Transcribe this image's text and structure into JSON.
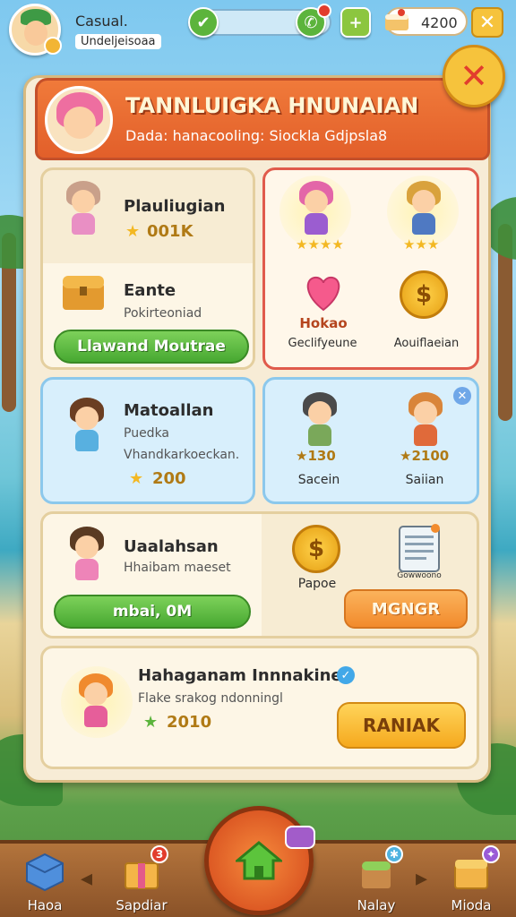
{
  "profile": {
    "name": "Casual.",
    "status": "Undeljeisoaa"
  },
  "currency": {
    "coins": "4200"
  },
  "panel": {
    "title": "TANNLUIGKA HNUNAIAN",
    "subtitle": "Dada: hanacooling: Siockla Gdjpsla8"
  },
  "cards": {
    "c1": {
      "name": "Plauliugian",
      "value": "001K"
    },
    "c2": {
      "name": "Eante",
      "desc": "Pokirteoniad",
      "button": "Llawand Moutrae"
    },
    "c3": {
      "char_a_stars": "★★★★",
      "char_b_stars": "★★★",
      "item_a_label": "Hokao",
      "item_a_caption": "Geclifyeune",
      "item_b_caption": "Aouiflaeian"
    },
    "c4": {
      "name": "Matoallan",
      "line1": "Puedka",
      "line2": "Vhandkarkoeckan.",
      "value": "200"
    },
    "c5": {
      "char_a_value": "★130",
      "char_a_label": "Sacein",
      "char_b_value": "★2100",
      "char_b_label": "Saiian"
    },
    "c6": {
      "name": "Uaalahsan",
      "desc": "Hhaibam maeset",
      "button": "mbai, 0M"
    },
    "c7": {
      "coin_label": "Papoe",
      "doc_label": "Gowwoono",
      "button": "MGNGR"
    },
    "c8": {
      "name": "Hahaganam Innnakine",
      "desc": "Flake srakog ndonningl",
      "value": "2010",
      "button": "RANIAK"
    }
  },
  "nav": {
    "items": [
      {
        "label": "Haoa"
      },
      {
        "label": "Sapdiar",
        "badge": "3"
      },
      {
        "label": "Nalay"
      },
      {
        "label": "Mioda"
      }
    ]
  }
}
